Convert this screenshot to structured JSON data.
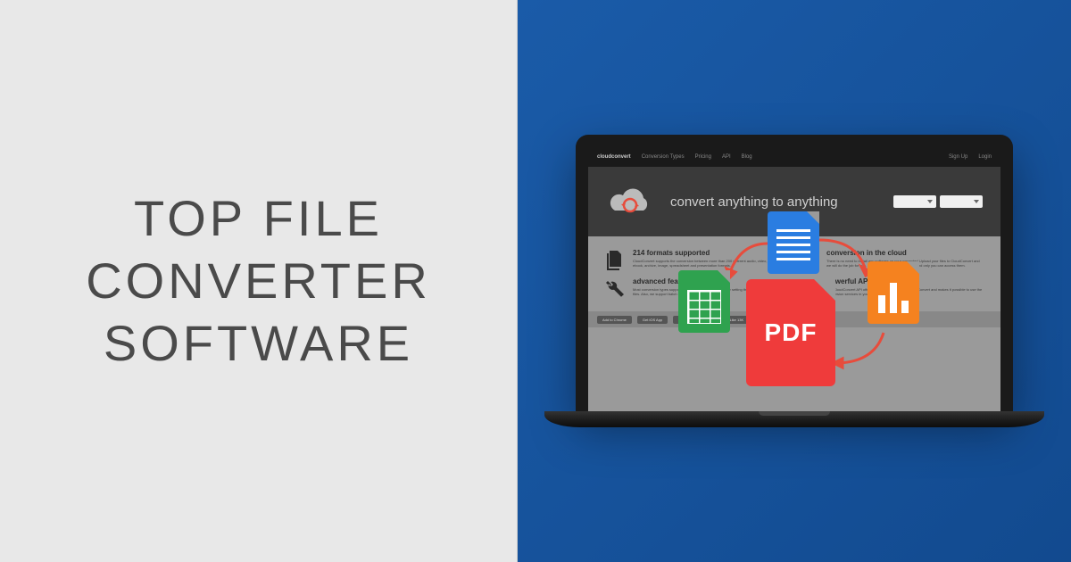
{
  "left": {
    "title_line1": "TOP FILE",
    "title_line2": "CONVERTER",
    "title_line3": "SOFTWARE"
  },
  "laptop": {
    "nav": {
      "brand": "cloudconvert",
      "items": [
        "Conversion Types",
        "Pricing",
        "API",
        "Blog"
      ],
      "right": [
        "Sign Up",
        "Login"
      ]
    },
    "hero": {
      "headline": "convert anything to anything"
    },
    "features": [
      {
        "title": "214 formats supported",
        "desc": "CloudConvert supports the conversion between more than 200 different audio, video, document, ebook, archive, image, spreadsheet and presentation formats."
      },
      {
        "title": "conversion in the cloud",
        "desc": "There is no need to install any software on your computer! Upload your files to CloudConvert and we will do the job for you. Don't worry, your files are safe and only you can access them."
      },
      {
        "title": "advanced features",
        "desc": "Most conversion types support advanced options, for example setting the codecs of audio/video files. Also, we support batch converting and folder monitoring!"
      },
      {
        "title": "powerful API",
        "desc": "The CloudConvert API offers the full functionality of CloudConvert and makes it possible to use the conversion services in your own applications."
      }
    ],
    "social": [
      "Add to Chrome",
      "Get iOS App",
      "Follow @cloudconvert",
      "Like 13K"
    ],
    "overlay": {
      "pdf_label": "PDF"
    }
  },
  "colors": {
    "blue_bg": "#1a5ba8",
    "grey_bg": "#e8e8e8",
    "pdf_red": "#ef3b3b",
    "doc_blue": "#2a7de1",
    "sheet_green": "#2fa24f",
    "chart_orange": "#f5821f"
  }
}
